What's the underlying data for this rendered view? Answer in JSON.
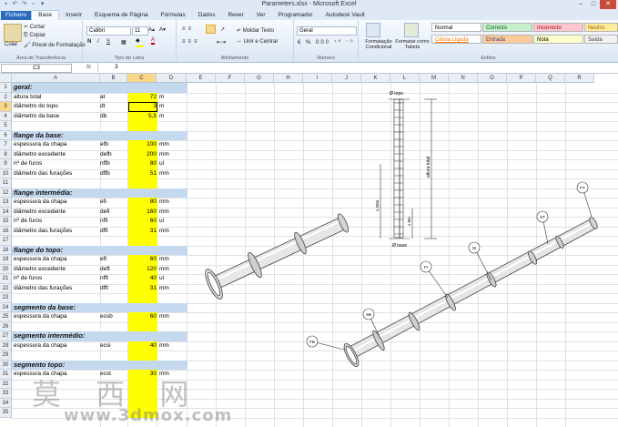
{
  "window": {
    "title": "Parameters.xlsx - Microsoft Excel",
    "qat": [
      "save-icon",
      "undo-icon",
      "redo-icon",
      "new-icon",
      "dropdown-icon"
    ],
    "buttons": {
      "minimize": "–",
      "maximize": "□",
      "close": "✕"
    }
  },
  "tabs": [
    {
      "label": "Ficheiro"
    },
    {
      "label": "Base"
    },
    {
      "label": "Inserir"
    },
    {
      "label": "Esquema de Página"
    },
    {
      "label": "Fórmulas"
    },
    {
      "label": "Dados"
    },
    {
      "label": "Rever"
    },
    {
      "label": "Ver"
    },
    {
      "label": "Programador"
    },
    {
      "label": "Autodesk Vault"
    }
  ],
  "ribbon": {
    "clipboard": {
      "paste": "Colar",
      "cut": "Cortar",
      "copy": "Copiar",
      "format_painter": "Pincel de Formatação",
      "label": "Área de Transferência"
    },
    "font": {
      "name": "Calibri",
      "size": "11",
      "bold": "N",
      "italic": "I",
      "underline": "S",
      "label": "Tipo de Letra"
    },
    "alignment": {
      "wrap": "Moldar Texto",
      "merge": "Unir e Centrar",
      "label": "Alinhamento"
    },
    "number": {
      "format": "Geral",
      "label": "Número"
    },
    "styles": {
      "conditional": "Formatação Condicional",
      "as_table": "Formatar como Tabela",
      "items": [
        {
          "label": "Normal",
          "bg": "#ffffff",
          "fg": "#000000"
        },
        {
          "label": "Correcto",
          "bg": "#c6efce",
          "fg": "#006100"
        },
        {
          "label": "Incorrecto",
          "bg": "#ffc7ce",
          "fg": "#9c0006"
        },
        {
          "label": "Neutro",
          "bg": "#ffeb9c",
          "fg": "#9c6500"
        },
        {
          "label": "Célula Ligada",
          "bg": "#ffffff",
          "fg": "#fa7d00"
        },
        {
          "label": "Entrada",
          "bg": "#ffcc99",
          "fg": "#3f3f76"
        },
        {
          "label": "Nota",
          "bg": "#ffffcc",
          "fg": "#000000"
        },
        {
          "label": "Saída",
          "bg": "#f2f2f2",
          "fg": "#3f3f3f"
        }
      ],
      "label": "Estilos"
    }
  },
  "formula_bar": {
    "name_box": "C3",
    "fx": "fx",
    "value": "3"
  },
  "columns": [
    "A",
    "B",
    "C",
    "D",
    "E",
    "F",
    "G",
    "H",
    "I",
    "J",
    "K",
    "L",
    "M",
    "N",
    "O",
    "P",
    "Q",
    "R"
  ],
  "rows": [
    "1",
    "2",
    "3",
    "4",
    "5",
    "6",
    "7",
    "8",
    "9",
    "10",
    "11",
    "12",
    "13",
    "14",
    "15",
    "16",
    "17",
    "18",
    "19",
    "20",
    "21",
    "22",
    "23",
    "24",
    "25",
    "26",
    "27",
    "28",
    "29",
    "30",
    "31",
    "32",
    "33",
    "34",
    "35"
  ],
  "sheet": {
    "sections": [
      {
        "row": 1,
        "label": "geral:"
      },
      {
        "row": 6,
        "label": "flange da base:"
      },
      {
        "row": 12,
        "label": "flange intermédia:"
      },
      {
        "row": 18,
        "label": "flange do topo:"
      },
      {
        "row": 24,
        "label": "segmento da base:"
      },
      {
        "row": 27,
        "label": "segmento intermédio:"
      },
      {
        "row": 30,
        "label": "segmento topo:"
      }
    ],
    "params": [
      {
        "row": 2,
        "name": "altura total",
        "sym": "at",
        "value": "72",
        "unit": "m"
      },
      {
        "row": 3,
        "name": "diâmetro do topo",
        "sym": "dt",
        "value": "3",
        "unit": "m"
      },
      {
        "row": 4,
        "name": "diâmetro da base",
        "sym": "db",
        "value": "5,5",
        "unit": "m"
      },
      {
        "row": 7,
        "name": "espessura da chapa",
        "sym": "efb",
        "value": "100",
        "unit": "mm"
      },
      {
        "row": 8,
        "name": "diâmetro excedente",
        "sym": "defb",
        "value": "200",
        "unit": "mm"
      },
      {
        "row": 9,
        "name": "nº de furos",
        "sym": "nffb",
        "value": "80",
        "unit": "ul"
      },
      {
        "row": 10,
        "name": "diâmetro das furações",
        "sym": "dffb",
        "value": "51",
        "unit": "mm"
      },
      {
        "row": 13,
        "name": "espessura da chapa",
        "sym": "efi",
        "value": "80",
        "unit": "mm"
      },
      {
        "row": 14,
        "name": "diâmetro excedente",
        "sym": "defi",
        "value": "160",
        "unit": "mm"
      },
      {
        "row": 15,
        "name": "nº de furos",
        "sym": "nffi",
        "value": "60",
        "unit": "ul"
      },
      {
        "row": 16,
        "name": "diâmetro das furações",
        "sym": "dffi",
        "value": "31",
        "unit": "mm"
      },
      {
        "row": 19,
        "name": "espessura da chapa",
        "sym": "eft",
        "value": "60",
        "unit": "mm"
      },
      {
        "row": 20,
        "name": "diâmetro excedente",
        "sym": "deft",
        "value": "120",
        "unit": "mm"
      },
      {
        "row": 21,
        "name": "nº de furos",
        "sym": "nfft",
        "value": "40",
        "unit": "ul"
      },
      {
        "row": 22,
        "name": "diâmetro das furações",
        "sym": "dfft",
        "value": "31",
        "unit": "mm"
      },
      {
        "row": 25,
        "name": "espessura da chapa",
        "sym": "ecsb",
        "value": "60",
        "unit": "mm"
      },
      {
        "row": 28,
        "name": "espessura da chapa",
        "sym": "ecsi",
        "value": "40",
        "unit": "mm"
      },
      {
        "row": 31,
        "name": "espessura da chapa",
        "sym": "ecst",
        "value": "30",
        "unit": "mm"
      }
    ]
  },
  "drawing": {
    "elevation_labels": {
      "top": "Ø topo",
      "total": "altura total",
      "base": "Ø base",
      "seg_bottom": "x 20m",
      "seg_top": "x 8m"
    },
    "callouts": [
      "FB",
      "SB",
      "FI",
      "SI",
      "ST",
      "FT"
    ]
  },
  "watermark": {
    "line1": "莫 西 网",
    "line2": "www.3dmox.com"
  }
}
